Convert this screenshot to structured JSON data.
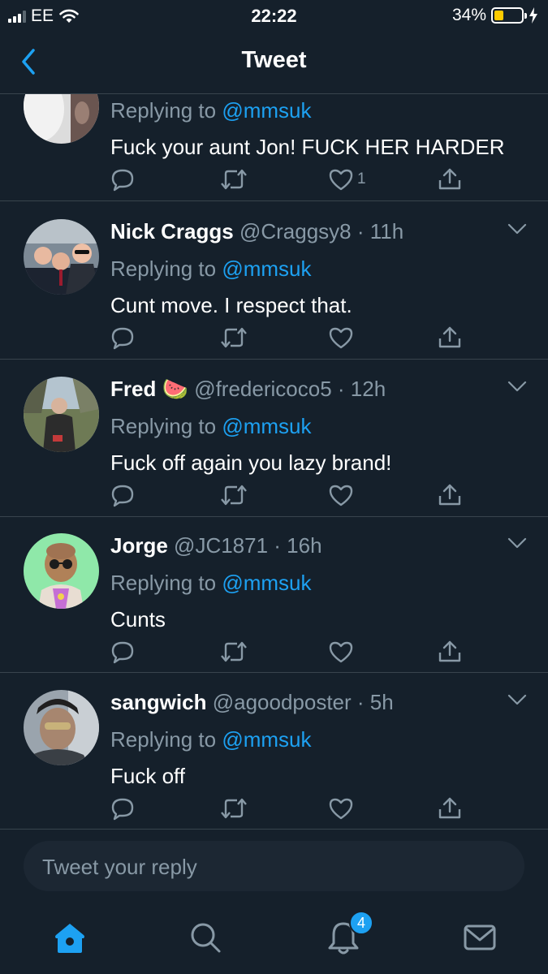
{
  "status_bar": {
    "carrier": "EE",
    "time": "22:22",
    "battery_percent": "34%",
    "battery_level": 0.34
  },
  "header": {
    "title": "Tweet"
  },
  "tweets": [
    {
      "name": "",
      "handle": "",
      "time": "",
      "replying_label": "Replying to",
      "mention": "@mmsuk",
      "text": "Fuck your aunt Jon! FUCK HER HARDER",
      "like_count": "1"
    },
    {
      "name": "Nick Craggs",
      "emoji": "",
      "handle": "@Craggsy8",
      "time": "11h",
      "replying_label": "Replying to",
      "mention": "@mmsuk",
      "text": "Cunt move. I respect that.",
      "like_count": ""
    },
    {
      "name": "Fred",
      "emoji": "🍉",
      "handle": "@fredericoco5",
      "time": "12h",
      "replying_label": "Replying to",
      "mention": "@mmsuk",
      "text": "Fuck off again you lazy brand!",
      "like_count": ""
    },
    {
      "name": "Jorge",
      "emoji": "",
      "handle": "@JC1871",
      "time": "16h",
      "replying_label": "Replying to",
      "mention": "@mmsuk",
      "text": "Cunts",
      "like_count": ""
    },
    {
      "name": "sangwich",
      "emoji": "",
      "handle": "@agoodposter",
      "time": "5h",
      "replying_label": "Replying to",
      "mention": "@mmsuk",
      "text": "Fuck off",
      "like_count": ""
    }
  ],
  "reply_box": {
    "placeholder": "Tweet your reply"
  },
  "tabbar": {
    "items": [
      "home-icon",
      "search-icon",
      "notifications-icon",
      "messages-icon"
    ],
    "notification_badge": "4"
  },
  "colors": {
    "background": "#15202b",
    "accent": "#1da1f2",
    "muted": "#8899a6",
    "divider": "#38444d",
    "battery": "#fecb00"
  }
}
